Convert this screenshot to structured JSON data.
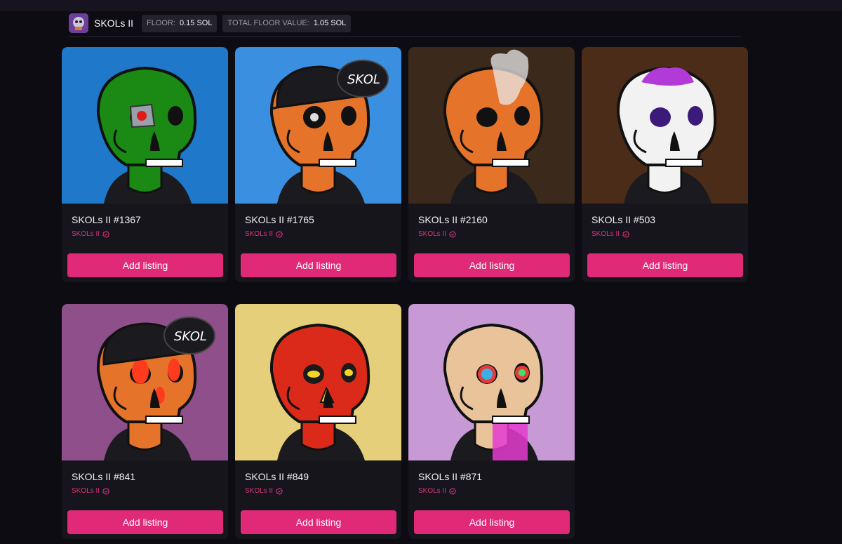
{
  "collection": {
    "name": "SKOLs II",
    "floor_label": "FLOOR:",
    "floor_value": "0.15 SOL",
    "total_label": "TOTAL FLOOR VALUE:",
    "total_value": "1.05 SOL"
  },
  "colors": {
    "accent": "#e02a78",
    "background": "#0d0c12",
    "card": "#16151c"
  },
  "cards": [
    {
      "title": "SKOLs II #1367",
      "collection": "SKOLs II",
      "button": "Add listing",
      "bg": "#1f78c9",
      "skull": "#1a8a14",
      "eyes": "cyborg-red",
      "hat": false
    },
    {
      "title": "SKOLs II #1765",
      "collection": "SKOLs II",
      "button": "Add listing",
      "bg": "#3a8fe0",
      "skull": "#e5732a",
      "eyes": "eyepatch",
      "hat": true,
      "hat_text": "SKOL"
    },
    {
      "title": "SKOLs II #2160",
      "collection": "SKOLs II",
      "button": "Add listing",
      "bg": "#3b2a1c",
      "skull": "#e5732a",
      "eyes": "smoke",
      "hat": false
    },
    {
      "title": "SKOLs II #503",
      "collection": "SKOLs II",
      "button": "Add listing",
      "bg": "#4a2c18",
      "skull": "#f2f2f2",
      "eyes": "purple",
      "hat": false
    },
    {
      "title": "SKOLs II #841",
      "collection": "SKOLs II",
      "button": "Add listing",
      "bg": "#8e4f8a",
      "skull": "#e5732a",
      "eyes": "fire",
      "hat": true,
      "hat_text": "SKOL"
    },
    {
      "title": "SKOLs II #849",
      "collection": "SKOLs II",
      "button": "Add listing",
      "bg": "#e6cf7a",
      "skull": "#dc2a1a",
      "eyes": "gold",
      "hat": false
    },
    {
      "title": "SKOLs II #871",
      "collection": "SKOLs II",
      "button": "Add listing",
      "bg": "#c79ad6",
      "skull": "#e9c49a",
      "eyes": "rainbow",
      "hat": false
    }
  ]
}
